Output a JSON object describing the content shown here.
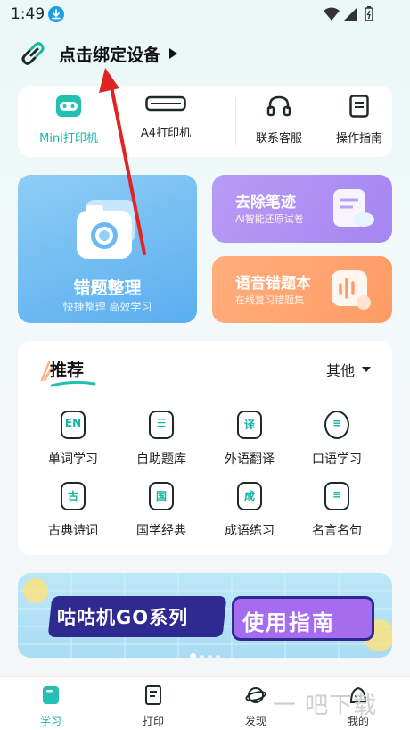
{
  "status_bar": {
    "time": "1:49"
  },
  "bind_device": {
    "label": "点击绑定设备"
  },
  "devices": [
    {
      "label": "Mini打印机",
      "icon": "mini-printer-icon",
      "active": true
    },
    {
      "label": "A4打印机",
      "icon": "a4-printer-icon",
      "active": false
    },
    {
      "label": "联系客服",
      "icon": "headset-icon",
      "active": false
    },
    {
      "label": "操作指南",
      "icon": "guide-document-icon",
      "active": false
    }
  ],
  "feature_cards": {
    "wrong_questions": {
      "title": "错题整理",
      "subtitle": "快捷整理 高效学习"
    },
    "remove_marks": {
      "title": "去除笔迹",
      "subtitle": "AI智能还原试卷"
    },
    "voice_book": {
      "title": "语音错题本",
      "subtitle": "在线复习错题集"
    }
  },
  "recommend": {
    "title": "推荐",
    "other_label": "其他",
    "items": [
      {
        "label": "单词学习",
        "glyph": "EN"
      },
      {
        "label": "自助题库",
        "glyph": "☰"
      },
      {
        "label": "外语翻译",
        "glyph": "译"
      },
      {
        "label": "口语学习",
        "glyph": "≡"
      },
      {
        "label": "古典诗词",
        "glyph": "古"
      },
      {
        "label": "国学经典",
        "glyph": "国"
      },
      {
        "label": "成语练习",
        "glyph": "成"
      },
      {
        "label": "名言名句",
        "glyph": "≡"
      }
    ]
  },
  "banner": {
    "left_text": "咕咕机GO系列",
    "right_text": "使用指南"
  },
  "tabs": [
    {
      "label": "学习",
      "active": true
    },
    {
      "label": "打印",
      "active": false
    },
    {
      "label": "发现",
      "active": false
    },
    {
      "label": "我的",
      "active": false
    }
  ],
  "watermark": "一 吧下载",
  "colors": {
    "accent": "#15b6a8",
    "annotation_arrow": "#e02424"
  }
}
